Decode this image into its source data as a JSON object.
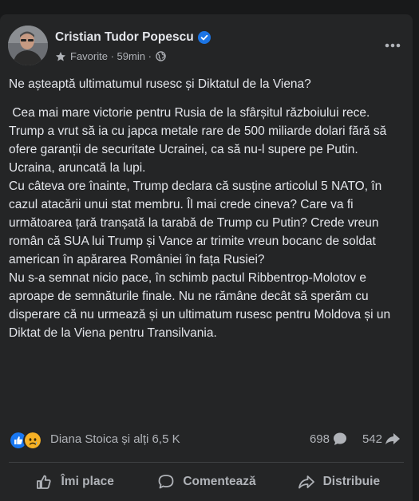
{
  "post": {
    "author": "Cristian Tudor Popescu",
    "audience": "Favorite",
    "time": "59min",
    "icons": {
      "verified": "verified-badge-icon",
      "audience": "star-icon",
      "privacy": "globe-icon",
      "more": "more-options-icon"
    },
    "paragraphs": [
      "Ne așteaptă ultimatumul rusesc și Diktatul de la Viena?",
      " Cea mai mare victorie pentru Rusia de la sfârșitul războiului rece. Trump a vrut să ia cu japca metale rare de 500 miliarde dolari fără să ofere garanții de securitate Ucrainei, ca să nu-l supere pe Putin.",
      "Ucraina, aruncată la lupi.",
      "Cu câteva ore înainte, Trump declara că susține articolul 5 NATO, în cazul atacării unui stat membru. Îl mai crede cineva? Care va fi următoarea țară tranșată la tarabă de Trump cu Putin? Crede vreun român că SUA lui Trump și Vance ar trimite vreun bocanc de soldat american în apărarea României în fața Rusiei?",
      "Nu s-a semnat nicio pace, în schimb pactul Ribbentrop-Molotov e aproape de semnăturile finale. Nu ne rămâne decât să sperăm cu disperare că nu urmează și un ultimatum rusesc pentru Moldova și un Diktat de la Viena pentru Transilvania."
    ],
    "reactions": {
      "types": [
        "like",
        "sad"
      ],
      "summary": "Diana Stoica și alți 6,5 K",
      "comments": "698",
      "shares": "542"
    },
    "actions": {
      "like": "Îmi place",
      "comment": "Comentează",
      "share": "Distribuie"
    }
  },
  "colors": {
    "background": "#18191a",
    "card": "#242526",
    "text": "#e4e6eb",
    "secondary_text": "#b0b3b8",
    "verified_blue": "#1b74e4",
    "like_blue": "#1877f2",
    "sad_yellow": "#f7b125"
  }
}
